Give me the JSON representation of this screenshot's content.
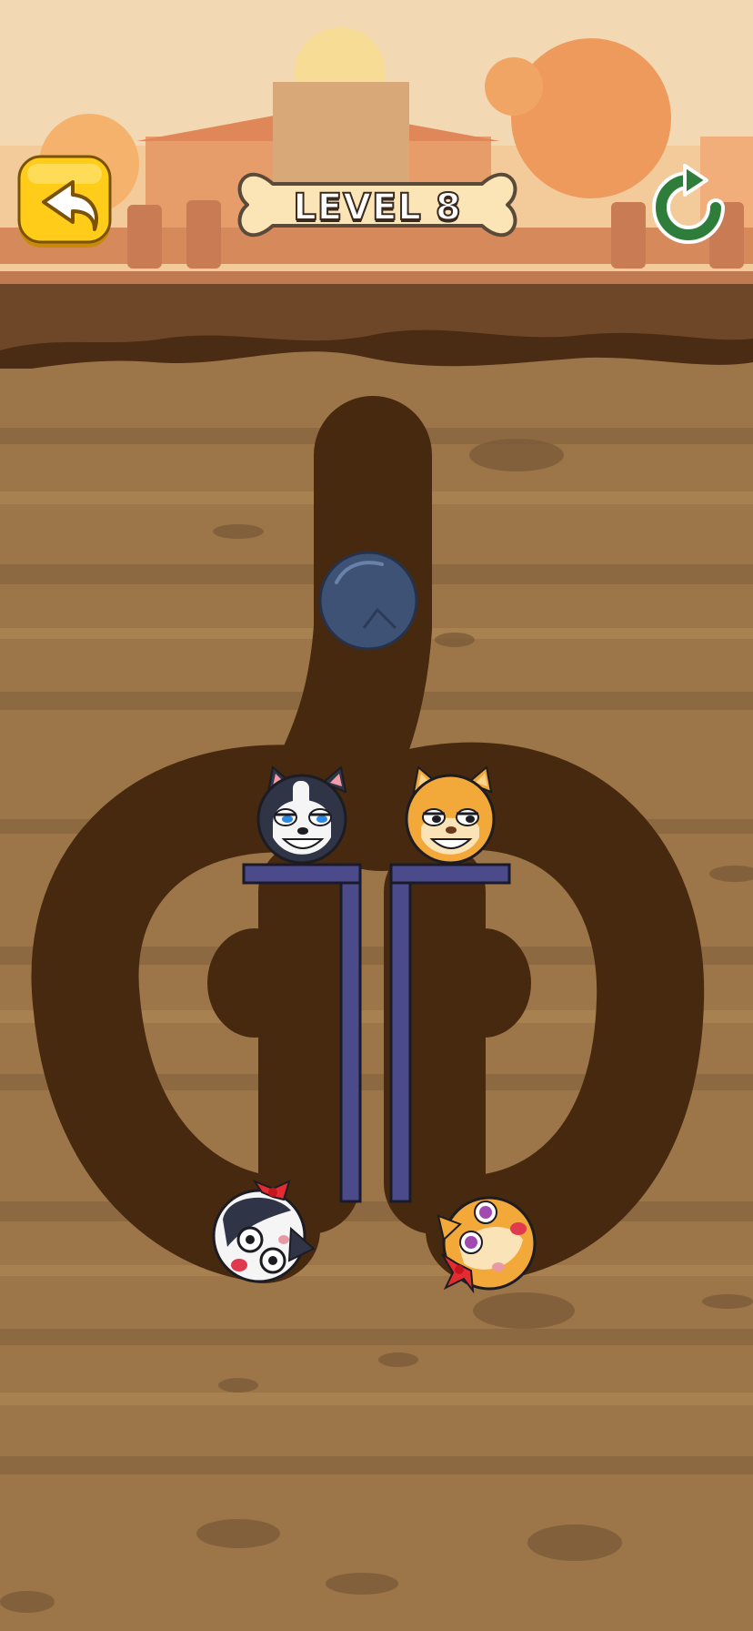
{
  "header": {
    "level_label": "LEVEL 8",
    "back_button_icon": "back-arrow-icon",
    "restart_button_icon": "restart-icon"
  },
  "colors": {
    "sky": "#f3d9b3",
    "ground": "#9c7548",
    "tunnel": "#46290f",
    "pins": "#4b4b8c",
    "accent_yellow": "#ffcc1a",
    "bone": "#fbe5b6"
  },
  "characters": [
    {
      "name": "husky-dog",
      "color": "#2f3547"
    },
    {
      "name": "shiba-dog",
      "color": "#f3a83a"
    },
    {
      "name": "husky-girl-dog",
      "color": "#2f3547"
    },
    {
      "name": "shiba-girl-dog",
      "color": "#f3a83a"
    }
  ],
  "objects": {
    "boulder": "stone-ball",
    "pins_count": 2
  }
}
